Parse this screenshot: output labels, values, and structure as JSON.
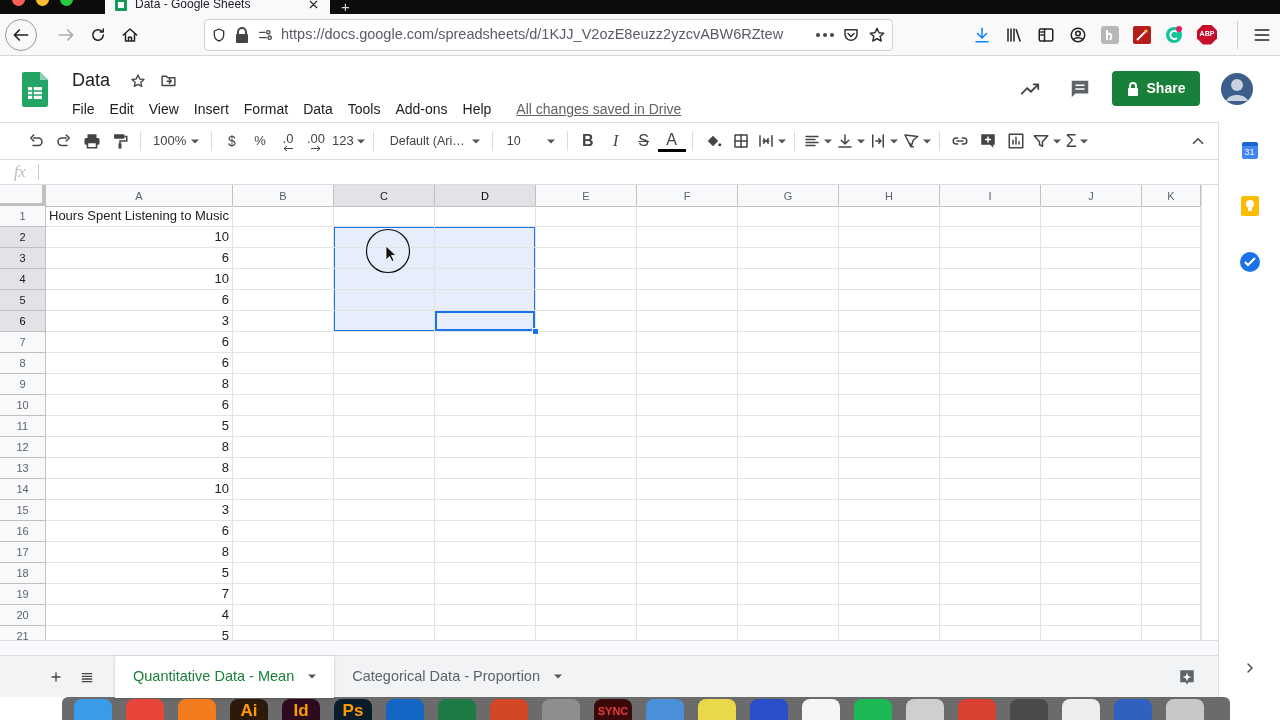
{
  "browser": {
    "tab_title": "Data - Google Sheets",
    "new_tab": "+",
    "url": "https://docs.google.com/spreadsheets/d/1KJJ_V2ozE8euzz2yzcvABW6RZtew",
    "adblock_label": "ABP"
  },
  "document": {
    "title": "Data",
    "menu": [
      "File",
      "Edit",
      "View",
      "Insert",
      "Format",
      "Data",
      "Tools",
      "Add-ons",
      "Help"
    ],
    "save_status": "All changes saved in Drive",
    "share_label": "Share"
  },
  "toolbar": {
    "zoom": "100%",
    "currency": "$",
    "percent": "%",
    "decimal_decrease": ".0",
    "decimal_increase": ".00",
    "more_formats": "123",
    "font": "Default (Ari…",
    "font_size": "10",
    "bold": "B",
    "italic": "I",
    "strikethrough": "S",
    "text_color": "A",
    "functions": "Σ"
  },
  "formula_bar": {
    "label": "fx"
  },
  "grid": {
    "columns": [
      {
        "label": "A",
        "selected": false,
        "active": false
      },
      {
        "label": "B",
        "selected": false,
        "active": false
      },
      {
        "label": "C",
        "selected": true,
        "active": false
      },
      {
        "label": "D",
        "selected": true,
        "active": true
      },
      {
        "label": "E",
        "selected": false,
        "active": false
      },
      {
        "label": "F",
        "selected": false,
        "active": false
      },
      {
        "label": "G",
        "selected": false,
        "active": false
      },
      {
        "label": "H",
        "selected": false,
        "active": false
      },
      {
        "label": "I",
        "selected": false,
        "active": false
      },
      {
        "label": "J",
        "selected": false,
        "active": false
      },
      {
        "label": "K",
        "selected": false,
        "active": false
      }
    ],
    "rows": [
      {
        "number": "1",
        "value": "Hours Spent Listening to Music",
        "kind": "text",
        "selected": false,
        "active": false
      },
      {
        "number": "2",
        "value": "10",
        "kind": "number",
        "selected": true,
        "active": false
      },
      {
        "number": "3",
        "value": "6",
        "kind": "number",
        "selected": true,
        "active": false
      },
      {
        "number": "4",
        "value": "10",
        "kind": "number",
        "selected": true,
        "active": false
      },
      {
        "number": "5",
        "value": "6",
        "kind": "number",
        "selected": true,
        "active": false
      },
      {
        "number": "6",
        "value": "3",
        "kind": "number",
        "selected": true,
        "active": true
      },
      {
        "number": "7",
        "value": "6",
        "kind": "number",
        "selected": false,
        "active": false
      },
      {
        "number": "8",
        "value": "6",
        "kind": "number",
        "selected": false,
        "active": false
      },
      {
        "number": "9",
        "value": "8",
        "kind": "number",
        "selected": false,
        "active": false
      },
      {
        "number": "10",
        "value": "6",
        "kind": "number",
        "selected": false,
        "active": false
      },
      {
        "number": "11",
        "value": "5",
        "kind": "number",
        "selected": false,
        "active": false
      },
      {
        "number": "12",
        "value": "8",
        "kind": "number",
        "selected": false,
        "active": false
      },
      {
        "number": "13",
        "value": "8",
        "kind": "number",
        "selected": false,
        "active": false
      },
      {
        "number": "14",
        "value": "10",
        "kind": "number",
        "selected": false,
        "active": false
      },
      {
        "number": "15",
        "value": "3",
        "kind": "number",
        "selected": false,
        "active": false
      },
      {
        "number": "16",
        "value": "6",
        "kind": "number",
        "selected": false,
        "active": false
      },
      {
        "number": "17",
        "value": "8",
        "kind": "number",
        "selected": false,
        "active": false
      },
      {
        "number": "18",
        "value": "5",
        "kind": "number",
        "selected": false,
        "active": false
      },
      {
        "number": "19",
        "value": "7",
        "kind": "number",
        "selected": false,
        "active": false
      },
      {
        "number": "20",
        "value": "4",
        "kind": "number",
        "selected": false,
        "active": false
      },
      {
        "number": "21",
        "value": "5",
        "kind": "number",
        "selected": false,
        "active": false
      }
    ]
  },
  "side_panel": {
    "calendar_day": "31"
  },
  "sheet_tabs": [
    {
      "label": "Quantitative Data - Mean",
      "selected": true
    },
    {
      "label": "Categorical Data - Proportion",
      "selected": false
    }
  ],
  "dock": [
    {
      "color": "#3a9be8"
    },
    {
      "color": "#e8463a"
    },
    {
      "color": "#f27b1e"
    },
    {
      "color": "#2b1a0a",
      "label": "Ai"
    },
    {
      "color": "#2d0a1c",
      "label": "Id"
    },
    {
      "color": "#0a1d2b",
      "label": "Ps"
    },
    {
      "color": "#1366c4"
    },
    {
      "color": "#1d7a45"
    },
    {
      "color": "#d24726"
    },
    {
      "color": "#8e8e8e"
    },
    {
      "color": "#3a0a0a",
      "label": "SYNC"
    },
    {
      "color": "#4a90d9"
    },
    {
      "color": "#e8d84a"
    },
    {
      "color": "#2a4fc8"
    },
    {
      "color": "#f5f5f5"
    },
    {
      "color": "#1db954"
    },
    {
      "color": "#cfcfcf"
    },
    {
      "color": "#d84030"
    },
    {
      "color": "#4a4a4a"
    },
    {
      "color": "#eeeeee"
    },
    {
      "color": "#3060c0"
    },
    {
      "color": "#c8c8c8"
    }
  ]
}
